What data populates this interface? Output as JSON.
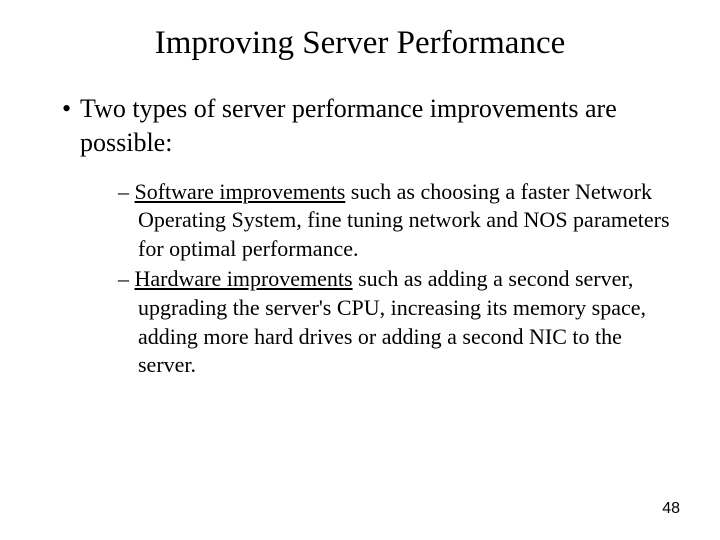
{
  "title": "Improving Server Performance",
  "level1": {
    "bullet": "•",
    "text": "Two types of server performance improvements are possible:"
  },
  "level2": [
    {
      "dash": "–",
      "underlined": "Software improvements",
      "rest": " such as choosing a faster Network Operating System, fine tuning network and NOS parameters for optimal performance."
    },
    {
      "dash": "–",
      "underlined": "Hardware improvements",
      "rest": " such as adding a second server, upgrading the server's CPU, increasing its memory space, adding more hard drives or adding a second NIC to the server."
    }
  ],
  "page_number": "48"
}
